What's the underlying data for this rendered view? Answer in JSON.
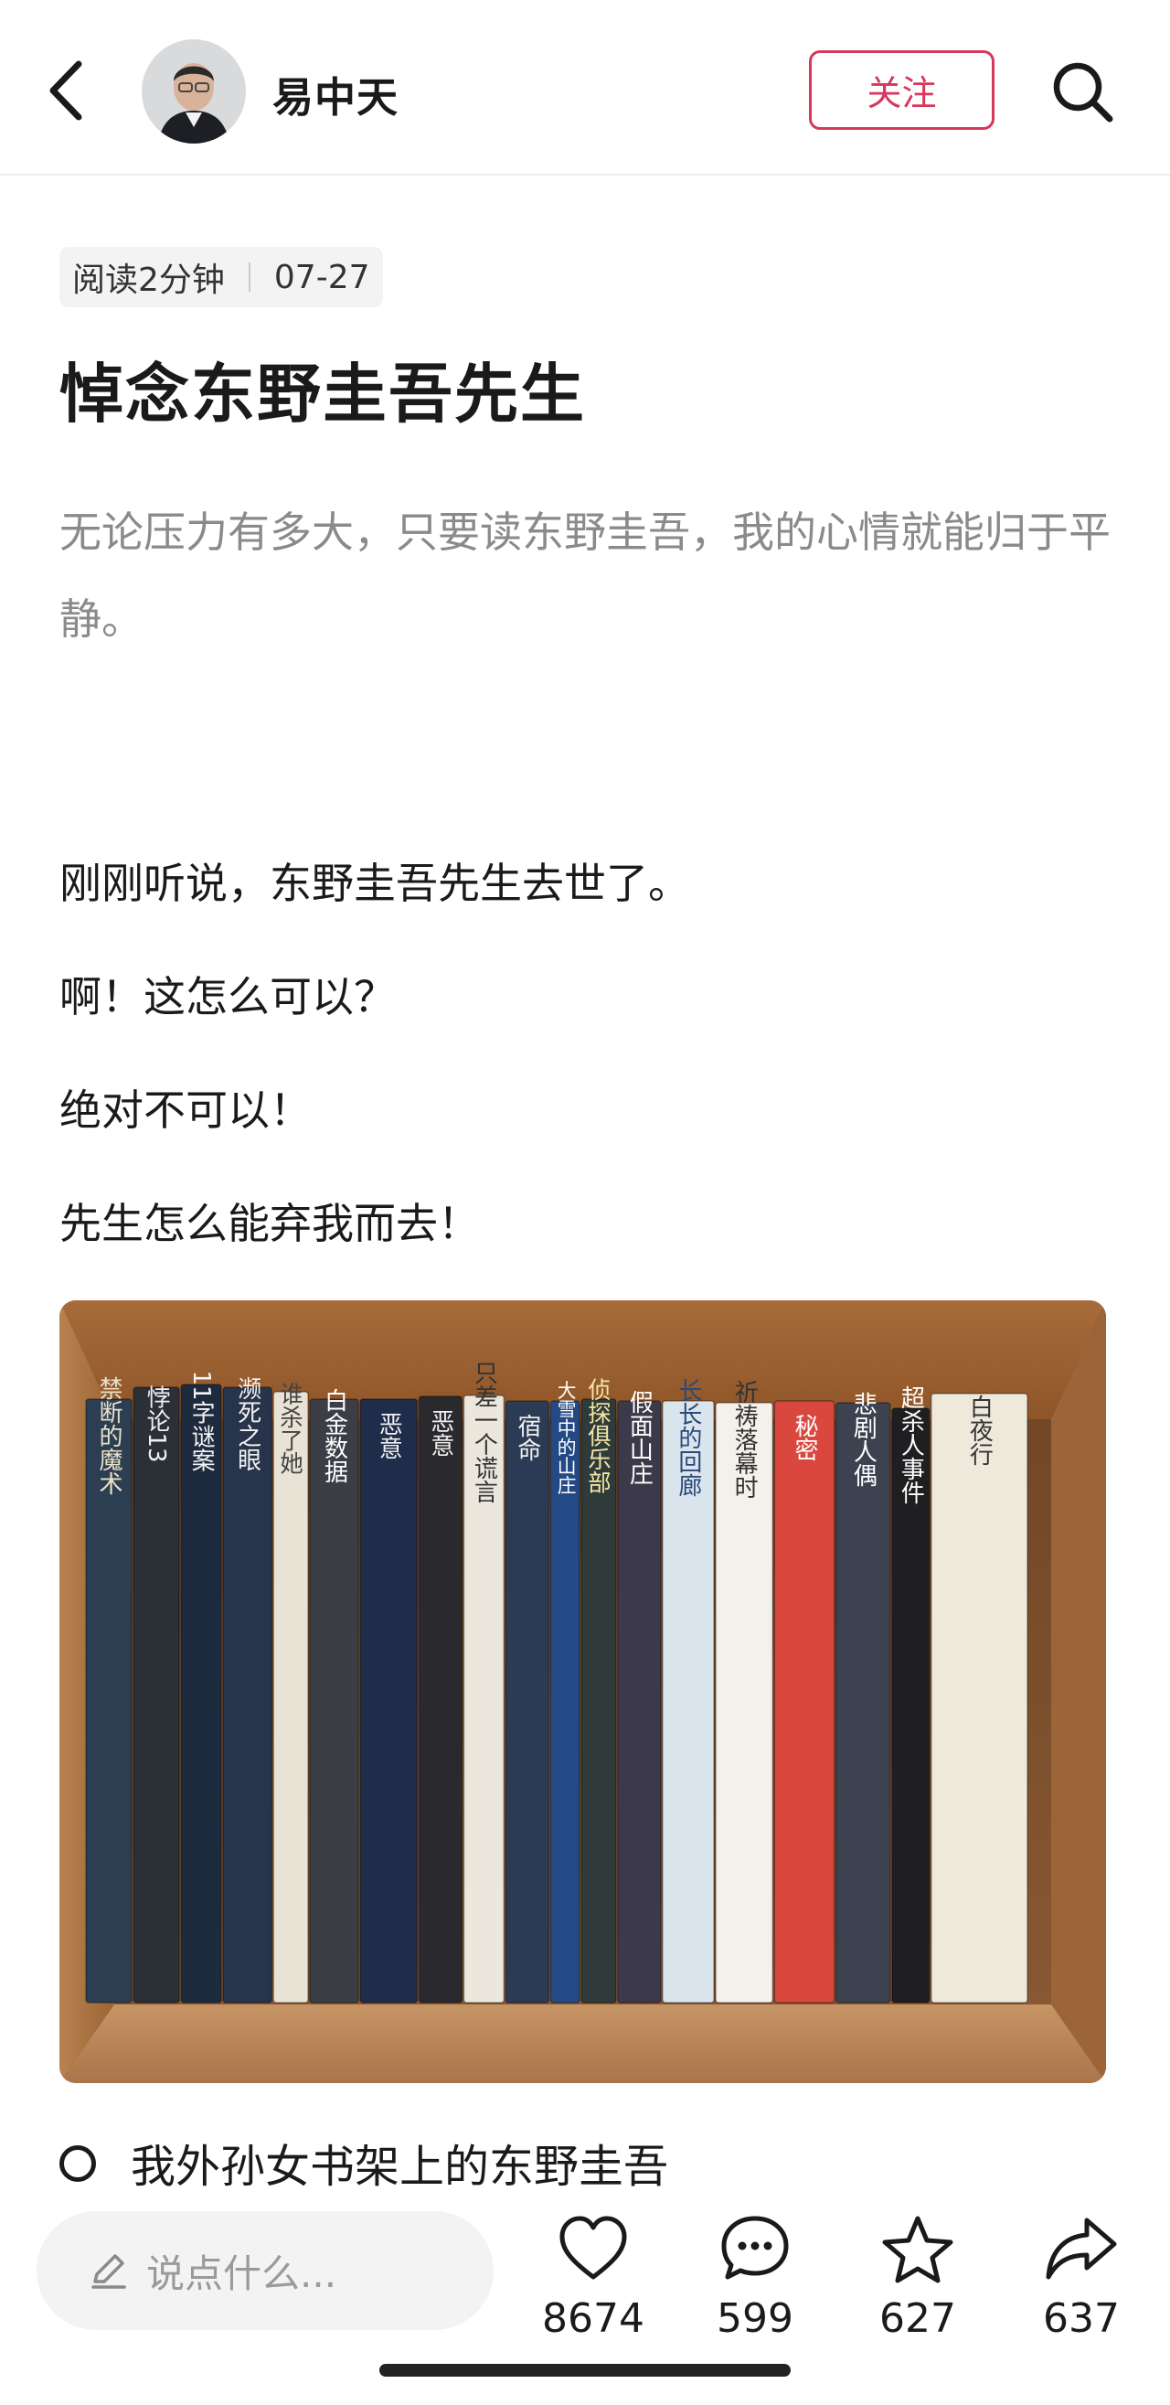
{
  "header": {
    "author": "易中天",
    "follow_label": "关注"
  },
  "article": {
    "read_time": "阅读2分钟",
    "date": "07-27",
    "title": "悼念东野圭吾先生",
    "summary": "无论压力有多大，只要读东野圭吾，我的心情就能归于平静。",
    "paragraphs": [
      "刚刚听说，东野圭吾先生去世了。",
      "啊！这怎么可以？",
      "绝对不可以！",
      "先生怎么能弃我而去！"
    ],
    "image_caption": "我外孙女书架上的东野圭吾"
  },
  "books": [
    {
      "title": "禁断的魔术",
      "color": "#2c3f52",
      "text": "#e9e0c8"
    },
    {
      "title": "悖论13",
      "color": "#2b2f36",
      "text": "#f0f0f0"
    },
    {
      "title": "11字谜案",
      "color": "#1e2b3f",
      "text": "#f3f3f3"
    },
    {
      "title": "濒死之眼",
      "color": "#28344c",
      "text": "#f3f3f3"
    },
    {
      "title": "谁杀了她",
      "color": "#e9e3d6",
      "text": "#444444"
    },
    {
      "title": "白金数据",
      "color": "#3b3f45",
      "text": "#ffffff"
    },
    {
      "title": "恶意",
      "color": "#1f2c4a",
      "text": "#f0f0f0"
    },
    {
      "title": "恶意",
      "color": "#2a2a2e",
      "text": "#f0f0f0"
    },
    {
      "title": "只差一个谎言",
      "color": "#ece7dc",
      "text": "#333333"
    },
    {
      "title": "宿命",
      "color": "#2c3b55",
      "text": "#f0f0f0"
    },
    {
      "title": "大雪中的山庄",
      "color": "#244a86",
      "text": "#ffffff"
    },
    {
      "title": "侦探俱乐部",
      "color": "#2f3a3a",
      "text": "#f3e7a6"
    },
    {
      "title": "假面山庄",
      "color": "#3c3a4a",
      "text": "#ffffff"
    },
    {
      "title": "长长的回廊",
      "color": "#d9e4ec",
      "text": "#2a4a7a"
    },
    {
      "title": "祈祷落幕时",
      "color": "#f4f1ea",
      "text": "#333333"
    },
    {
      "title": "秘密",
      "color": "#d9473f",
      "text": "#ffffff"
    },
    {
      "title": "悲剧人偶",
      "color": "#3d4250",
      "text": "#ffffff"
    },
    {
      "title": "超杀人事件",
      "color": "#1f1f22",
      "text": "#ffffff"
    },
    {
      "title": "白夜行",
      "color": "#efe9db",
      "text": "#333333"
    }
  ],
  "bottom": {
    "comment_placeholder": "说点什么...",
    "likes": "8674",
    "comments": "599",
    "favorites": "627",
    "shares": "637"
  },
  "colors": {
    "accent": "#d6375b",
    "text": "#1a1a1a",
    "muted": "#8a8a8a"
  },
  "icons": [
    "back-arrow-icon",
    "search-icon",
    "pencil-icon",
    "heart-icon",
    "comment-icon",
    "star-icon",
    "share-icon"
  ]
}
